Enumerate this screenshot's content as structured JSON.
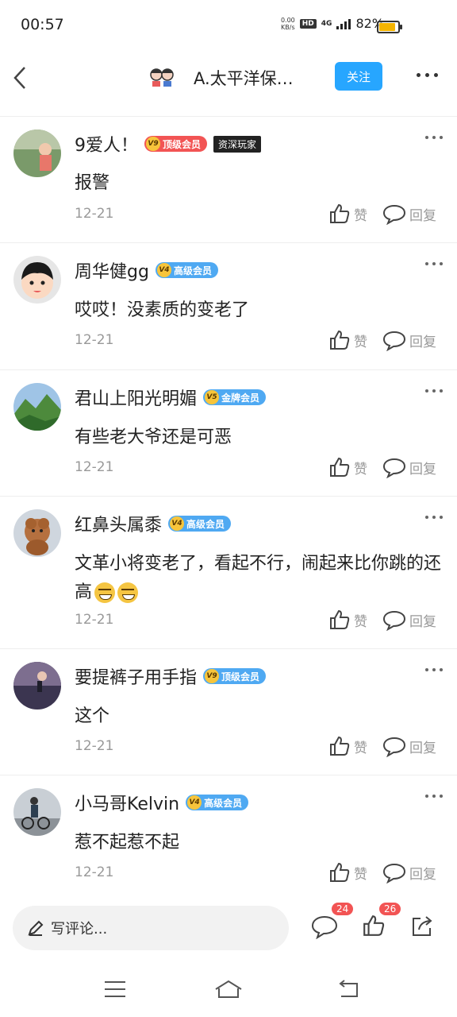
{
  "status_bar": {
    "time": "00:57",
    "speed_value": "0.00",
    "speed_unit": "KB/s",
    "hd": "HD",
    "net": "4G",
    "battery": "82%"
  },
  "header": {
    "title": "A.太平洋保…",
    "follow_label": "关注"
  },
  "labels": {
    "like": "赞",
    "reply": "回复"
  },
  "comments": [
    {
      "name": "9爱人！",
      "badge": "顶级会员",
      "badge_level": "V9",
      "tag": "资深玩家",
      "text": "报警",
      "date": "12-21"
    },
    {
      "name": "周华健gg",
      "badge": "高级会员",
      "badge_level": "V4",
      "text": "哎哎！没素质的变老了",
      "date": "12-21"
    },
    {
      "name": "君山上阳光明媚",
      "badge": "金牌会员",
      "badge_level": "V5",
      "text": "有些老大爷还是可恶",
      "date": "12-21"
    },
    {
      "name": "红鼻头属黍",
      "badge": "高级会员",
      "badge_level": "V4",
      "text": "文革小将变老了，看起不行，闹起来比你跳的还高",
      "date": "12-21"
    },
    {
      "name": "要提裤子用手指",
      "badge": "顶级会员",
      "badge_level": "V9",
      "text": "这个",
      "date": "12-21"
    },
    {
      "name": "小马哥Kelvin",
      "badge": "高级会员",
      "badge_level": "V4",
      "text": "惹不起惹不起",
      "date": "12-21"
    }
  ],
  "bottom_bar": {
    "placeholder": "写评论...",
    "comment_count": "24",
    "like_count": "26"
  },
  "icons": [
    "back-icon",
    "more-icon",
    "like-icon",
    "reply-icon",
    "pen-icon",
    "comment-icon",
    "share-icon",
    "menu-icon",
    "home-icon",
    "return-icon"
  ],
  "colors": {
    "accent": "#27a6ff",
    "badge_red": "#f25454",
    "badge_blue": "#4fa9f2",
    "muted": "#999999"
  }
}
